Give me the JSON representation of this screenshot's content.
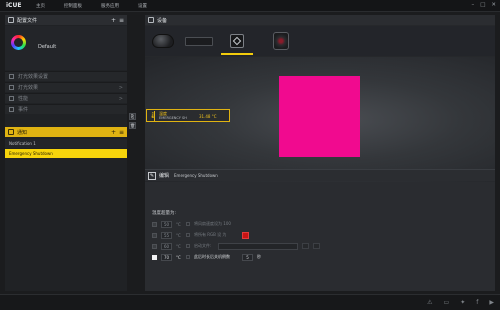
{
  "app": {
    "brand": "iCUE"
  },
  "topnav": [
    "主页",
    "控制面板",
    "服务应用",
    "设置"
  ],
  "profiles": {
    "header": "配置文件",
    "add": "+",
    "menu": "≡",
    "current": "Default"
  },
  "menu": [
    {
      "label": "灯光效果设置",
      "arrow": ""
    },
    {
      "label": "灯光效果",
      "arrow": ">"
    },
    {
      "label": "性能",
      "arrow": ">"
    },
    {
      "label": "事件",
      "arrow": ""
    }
  ],
  "notifications": {
    "header": "通知",
    "add": "+",
    "menu": "≡",
    "items": [
      "Notification 1",
      "Emergency Shutdown"
    ],
    "selected_index": 1
  },
  "devices": {
    "header": "设备",
    "selected": "lighting-node"
  },
  "tag": {
    "title": "温度",
    "subtitle": "EMERGENCY SH",
    "value": "31.48 °C"
  },
  "swatch_color": "#f10a8f",
  "editor": {
    "header": "编辑",
    "subtitle": "Emergency Shutdown",
    "title": "温度超量为:",
    "rows": [
      {
        "num": "50",
        "unit": "°C",
        "label": "将风扇速度设为 100",
        "checked": false
      },
      {
        "num": "55",
        "unit": "°C",
        "label": "将所有 RGB 设 为",
        "checked": false
      },
      {
        "num": "60",
        "unit": "°C",
        "label": "启动文件:",
        "checked": false
      },
      {
        "num": "70",
        "unit": "°C",
        "label": "此后时长后关机倒数",
        "checked": true,
        "after_num": "5",
        "after_unit": "秒"
      }
    ]
  },
  "bottom_icons": [
    "warning-icon",
    "chat-icon",
    "twitter-icon",
    "facebook-icon",
    "youtube-icon"
  ]
}
